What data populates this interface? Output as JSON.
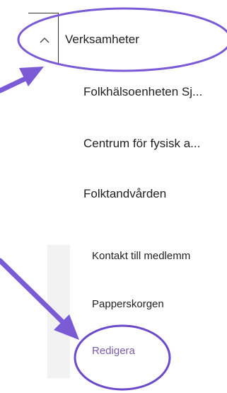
{
  "nav": {
    "section_label": "Verksamheter",
    "items": [
      {
        "label": "Folkhälsoenheten Sj..."
      },
      {
        "label": "Centrum för fysisk a..."
      },
      {
        "label": "Folktandvården"
      }
    ]
  },
  "bottom_nav": {
    "items": [
      {
        "label": "Kontakt till medlemm"
      },
      {
        "label": "Papperskorgen"
      }
    ],
    "edit_label": "Redigera"
  },
  "colors": {
    "annotation": "#7b5ad6",
    "edit_link": "#7a5ca8",
    "text": "#1f1f1f",
    "rail": "#f2f2f2"
  }
}
